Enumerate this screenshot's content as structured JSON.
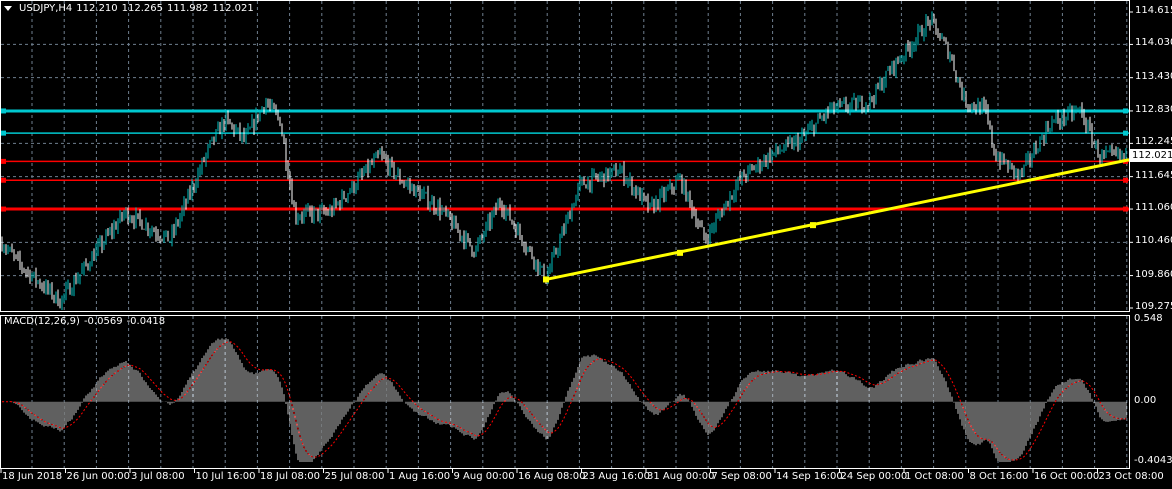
{
  "header": {
    "symbol": "USDJPY,H4",
    "open": "112.210",
    "high": "112.265",
    "low": "111.982",
    "close": "112.021"
  },
  "price_axis": [
    "114.615",
    "114.030",
    "113.430",
    "112.830",
    "112.245",
    "111.645",
    "111.060",
    "110.460",
    "109.860",
    "109.275"
  ],
  "current_price": "112.021",
  "macd": {
    "label": "MACD(12,26,9)",
    "main": "-0.0569",
    "signal": "-0.0418",
    "axis": [
      "0.548",
      "0.00",
      "-0.4043"
    ]
  },
  "time_axis": [
    "18 Jun 2018",
    "26 Jun 00:00",
    "3 Jul 08:00",
    "10 Jul 16:00",
    "18 Jul 08:00",
    "25 Jul 08:00",
    "1 Aug 16:00",
    "9 Aug 00:00",
    "16 Aug 08:00",
    "23 Aug 16:00",
    "31 Aug 00:00",
    "7 Sep 08:00",
    "14 Sep 16:00",
    "24 Sep 00:00",
    "1 Oct 08:00",
    "8 Oct 16:00",
    "16 Oct 00:00",
    "23 Oct 08:00"
  ],
  "colors": {
    "up": "#00c0c0",
    "down": "#ffffff",
    "support": "#ff0000",
    "resistance": "#00c8d0",
    "trend": "#ffff00",
    "hist": "#c0c0c0",
    "signal": "#ff0000",
    "grid": "#6f7f8f"
  },
  "chart_data": {
    "type": "line",
    "title": "USDJPY,H4",
    "ylim": [
      109.275,
      114.615
    ],
    "path_waypoints": [
      [
        0,
        110.5
      ],
      [
        20,
        110.05
      ],
      [
        60,
        109.4
      ],
      [
        125,
        111.0
      ],
      [
        170,
        110.5
      ],
      [
        210,
        112.2
      ],
      [
        225,
        112.66
      ],
      [
        245,
        112.3
      ],
      [
        265,
        113.0
      ],
      [
        280,
        112.66
      ],
      [
        295,
        110.95
      ],
      [
        330,
        111.0
      ],
      [
        380,
        112.03
      ],
      [
        400,
        111.6
      ],
      [
        440,
        111.06
      ],
      [
        475,
        110.3
      ],
      [
        500,
        111.2
      ],
      [
        546,
        109.8
      ],
      [
        580,
        111.5
      ],
      [
        620,
        111.76
      ],
      [
        650,
        111.06
      ],
      [
        680,
        111.6
      ],
      [
        705,
        110.5
      ],
      [
        740,
        111.6
      ],
      [
        770,
        112.03
      ],
      [
        800,
        112.3
      ],
      [
        830,
        112.85
      ],
      [
        870,
        113.0
      ],
      [
        890,
        113.57
      ],
      [
        910,
        114.0
      ],
      [
        930,
        114.47
      ],
      [
        950,
        113.85
      ],
      [
        965,
        113.0
      ],
      [
        985,
        112.85
      ],
      [
        995,
        112.03
      ],
      [
        1020,
        111.66
      ],
      [
        1050,
        112.6
      ],
      [
        1080,
        112.85
      ],
      [
        1100,
        112.0
      ],
      [
        1129,
        112.02
      ]
    ],
    "horizontal_levels": [
      {
        "price": 112.83,
        "color": "#00c8d0",
        "thick": true
      },
      {
        "price": 112.43,
        "color": "#00c8d0",
        "thick": false
      },
      {
        "price": 111.92,
        "color": "#ff0000",
        "thick": false
      },
      {
        "price": 111.58,
        "color": "#ff0000",
        "thick": false
      },
      {
        "price": 111.06,
        "color": "#ff0000",
        "thick": true
      }
    ],
    "trendline": {
      "points": [
        [
          546,
          109.79
        ],
        [
          680,
          110.27
        ],
        [
          813,
          110.77
        ]
      ],
      "end": [
        1129,
        111.95
      ]
    }
  }
}
